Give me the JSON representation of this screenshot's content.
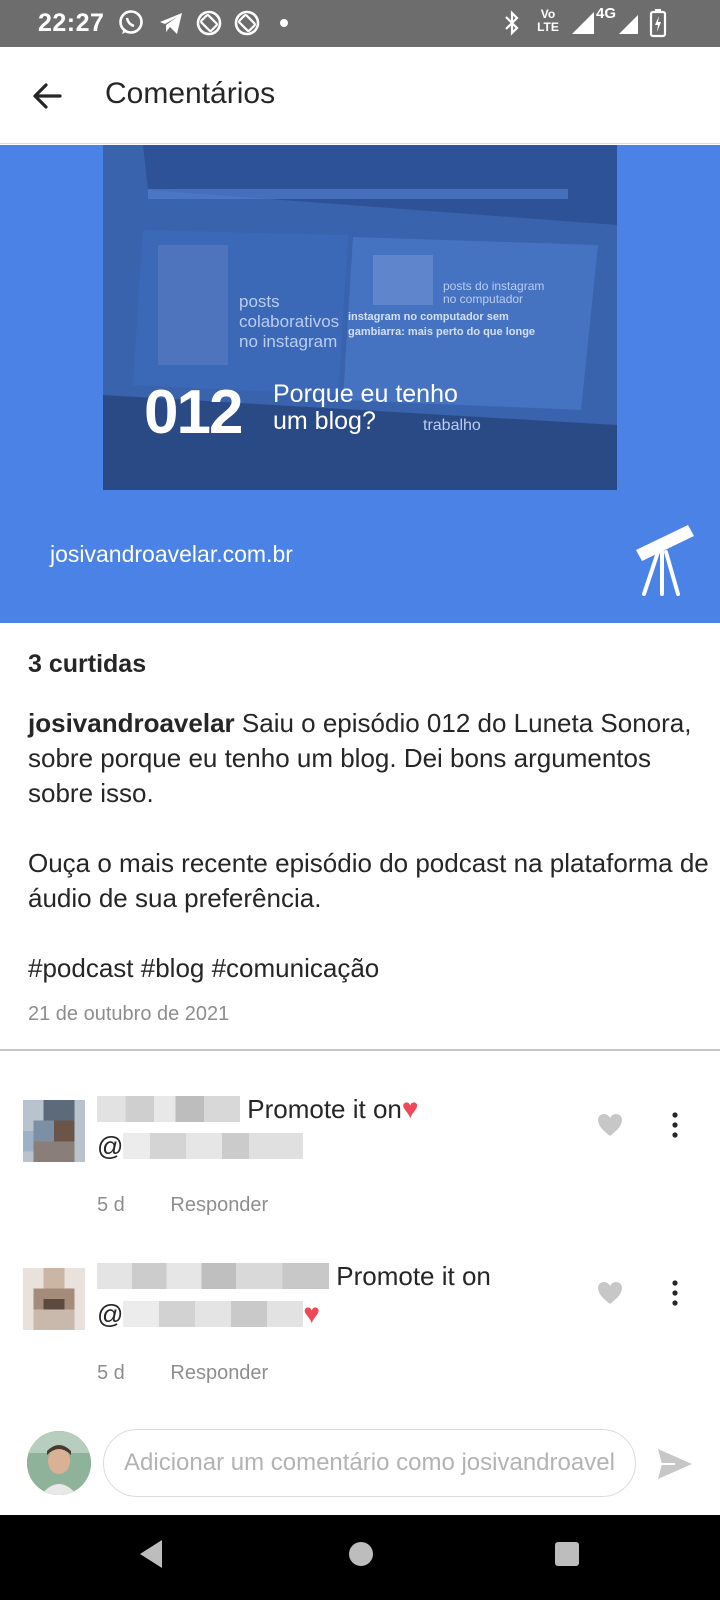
{
  "status_bar": {
    "time": "22:27",
    "icons_left": [
      "whatsapp-icon",
      "telegram-icon",
      "rotation-off-icon",
      "rotation-off-icon",
      "dot-icon"
    ],
    "icons_right": [
      "bluetooth-icon",
      "volte-icon",
      "signal-icon",
      "network-4g-icon",
      "battery-charging-icon"
    ],
    "volte_label": "Vo LTE",
    "network_label": "4G"
  },
  "header": {
    "title": "Comentários",
    "back_icon": "arrow-left-icon"
  },
  "post": {
    "image": {
      "episode_number": "012",
      "episode_title_line1": "Porque eu tenho",
      "episode_title_line2": "um blog?",
      "site": "josivandroavelar.com.br",
      "background_color": "#4a82e6",
      "logo_icon": "telescope-icon"
    },
    "likes": "3 curtidas",
    "caption": {
      "username": "josivandroavelar",
      "text": "Saiu o episódio 012 do Luneta Sonora, sobre porque eu tenho um blog. Dei bons argumentos sobre isso.",
      "paragraph2": "Ouça o mais recente episódio do podcast na plataforma de áudio de sua preferência.",
      "hashtags": "#podcast #blog #comunicação"
    },
    "date": "21 de outubro de 2021"
  },
  "comments": [
    {
      "text_after_name": "Promote it on",
      "mention_prefix": "@",
      "heart_after": "name",
      "age": "5 d",
      "reply_label": "Responder"
    },
    {
      "text_after_name": "Promote it on",
      "mention_prefix": "@",
      "heart_after": "mention",
      "age": "5 d",
      "reply_label": "Responder"
    }
  ],
  "composer": {
    "placeholder": "Adicionar um comentário como josivandroavelar",
    "send_icon": "send-icon"
  },
  "nav": {
    "icons": [
      "back-triangle-icon",
      "home-circle-icon",
      "recents-square-icon"
    ]
  },
  "colors": {
    "accent_blue": "#4a82e6",
    "heart_red": "#ed4956",
    "meta_gray": "#8e8e8e"
  }
}
